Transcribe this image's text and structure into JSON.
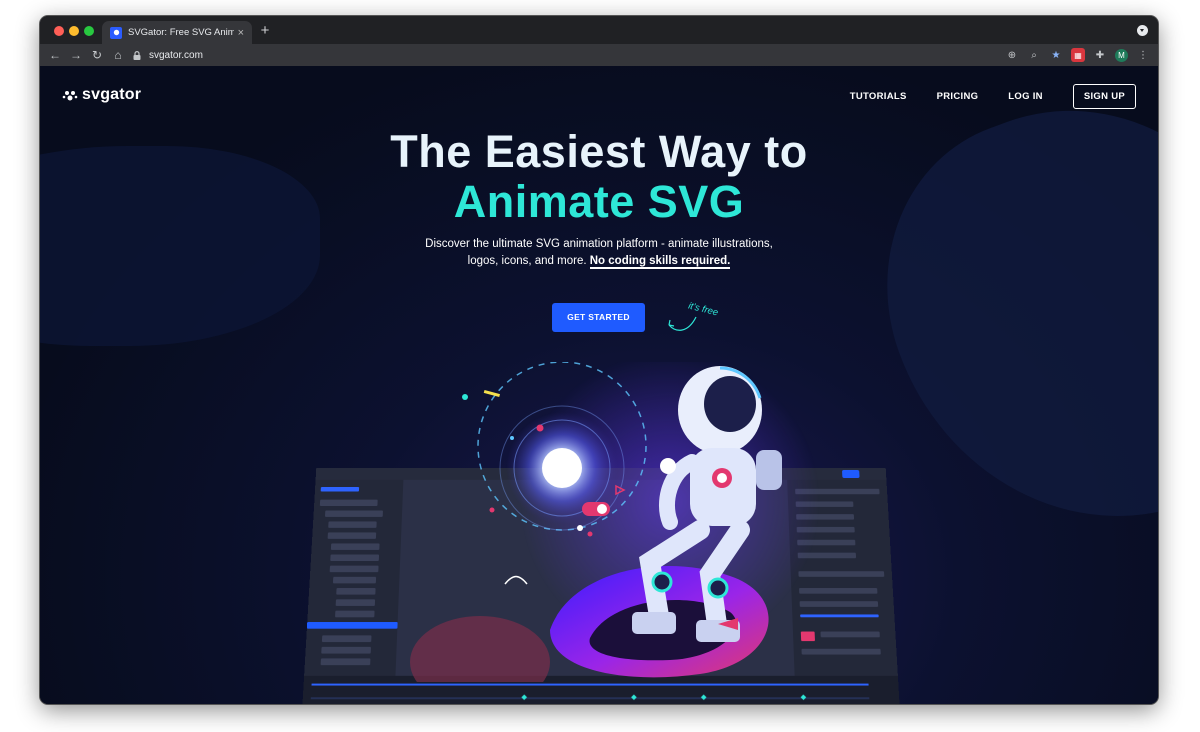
{
  "browser": {
    "tab_title": "SVGator: Free SVG Animation",
    "new_tab": "+",
    "url": "svgator.com",
    "avatar_letter": "M"
  },
  "site": {
    "logo_text": "svgator",
    "nav": {
      "tutorials": "TUTORIALS",
      "pricing": "PRICING",
      "login": "LOG IN",
      "signup": "SIGN UP"
    },
    "hero": {
      "title_line1": "The Easiest Way to",
      "title_line2": "Animate SVG",
      "subtitle_part1": "Discover the ultimate SVG animation platform - animate illustrations,",
      "subtitle_part2": "logos, icons, and more.",
      "subtitle_emphasis": "No coding skills required.",
      "cta": "GET STARTED",
      "free_note": "it's free"
    }
  },
  "colors": {
    "accent_cyan": "#2ee7d7",
    "brand_blue": "#1f5bff",
    "background": "#070c1d"
  }
}
